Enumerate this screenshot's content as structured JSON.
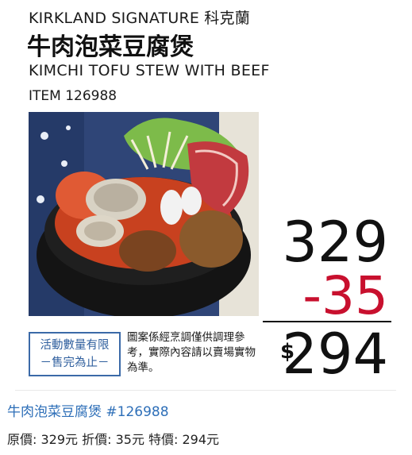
{
  "flyer": {
    "brand": "KIRKLAND SIGNATURE 科克蘭",
    "title_zh": "牛肉泡菜豆腐煲",
    "title_en": "KIMCHI TOFU STEW WITH BEEF",
    "item_number": "ITEM 126988",
    "price_original": "329",
    "price_discount": "-35",
    "currency_symbol": "$",
    "price_final": "294",
    "limited_line1": "活動數量有限",
    "limited_line2": "－售完為止－",
    "disclaimer": "圖案係經烹調僅供調理參考，實際內容請以賣場實物為準。",
    "colors": {
      "discount": "#c8102e",
      "badge_blue": "#3b6aa8",
      "link_blue": "#2e6fb8"
    }
  },
  "post": {
    "title": "牛肉泡菜豆腐煲 #126988",
    "price_line": "原價: 329元 折價: 35元 特價: 294元"
  }
}
